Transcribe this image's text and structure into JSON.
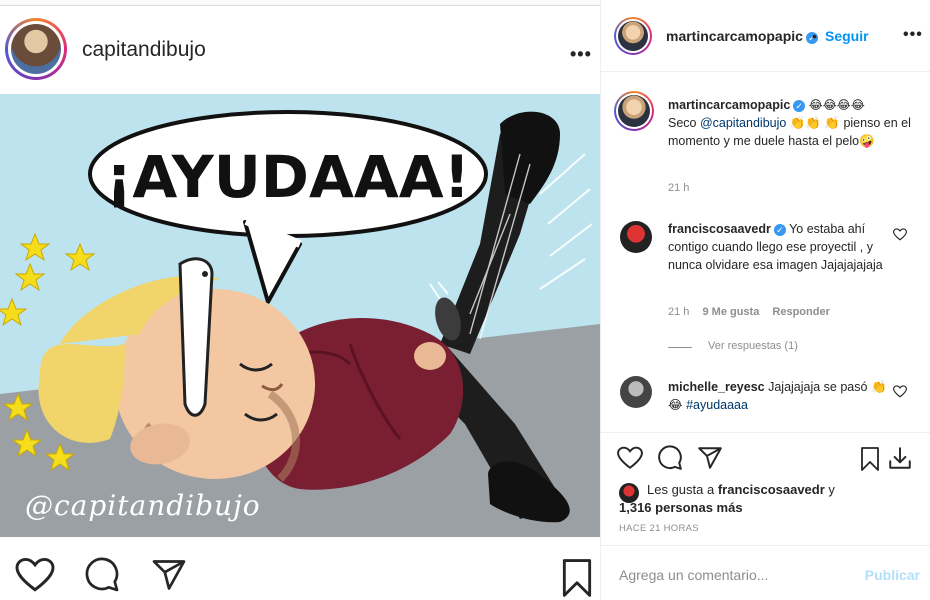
{
  "post": {
    "author": "capitandibujo",
    "image": {
      "speech_text": "¡AYUDAAA!",
      "watermark": "@capitandibujo"
    }
  },
  "sidebar": {
    "author": "martincarcamopapic",
    "follow_label": "Seguir",
    "separator": "•",
    "caption": {
      "author": "martincarcamopapic",
      "emojis_after_name": "😂😂😂😂",
      "text_before_mention": "Seco ",
      "mention": "@capitandibujo",
      "text_after_mention": " 👏👏 👏 pienso en el momento y me duele hasta el pelo🤪",
      "time": "21 h"
    },
    "comments": [
      {
        "author": "franciscosaavedr",
        "verified": true,
        "text": "Yo estaba ahí contigo cuando llego ese proyectil , y nunca olvidare esa imagen Jajajajajaja",
        "time": "21 h",
        "likes": "9 Me gusta",
        "reply_label": "Responder",
        "view_replies": "Ver respuestas (1)"
      },
      {
        "author": "michelle_reyesc",
        "verified": false,
        "text_before_tag": "Jajajajaja se pasó 👏😂 ",
        "hashtag": "#ayudaaaa"
      }
    ],
    "likes": {
      "prefix": "Les gusta a ",
      "user": "franciscosaavedr",
      "middle": " y",
      "count_text": "1,316 personas más"
    },
    "posted_ago": "HACE 21 HORAS",
    "add_comment": {
      "placeholder": "Agrega un comentario...",
      "publish_label": "Publicar"
    }
  },
  "colors": {
    "link_blue": "#0095f6",
    "mention_blue": "#00376b",
    "muted": "#8e8e8e",
    "publish_disabled": "#b2dffc",
    "post_background": "#bde4ee",
    "jacket": "#7a1f32"
  },
  "icons": {
    "left_actions": [
      "heart-icon",
      "comment-icon",
      "share-icon",
      "bookmark-icon"
    ],
    "right_actions": [
      "heart-icon",
      "comment-icon",
      "share-icon",
      "bookmark-icon",
      "download-icon"
    ]
  }
}
